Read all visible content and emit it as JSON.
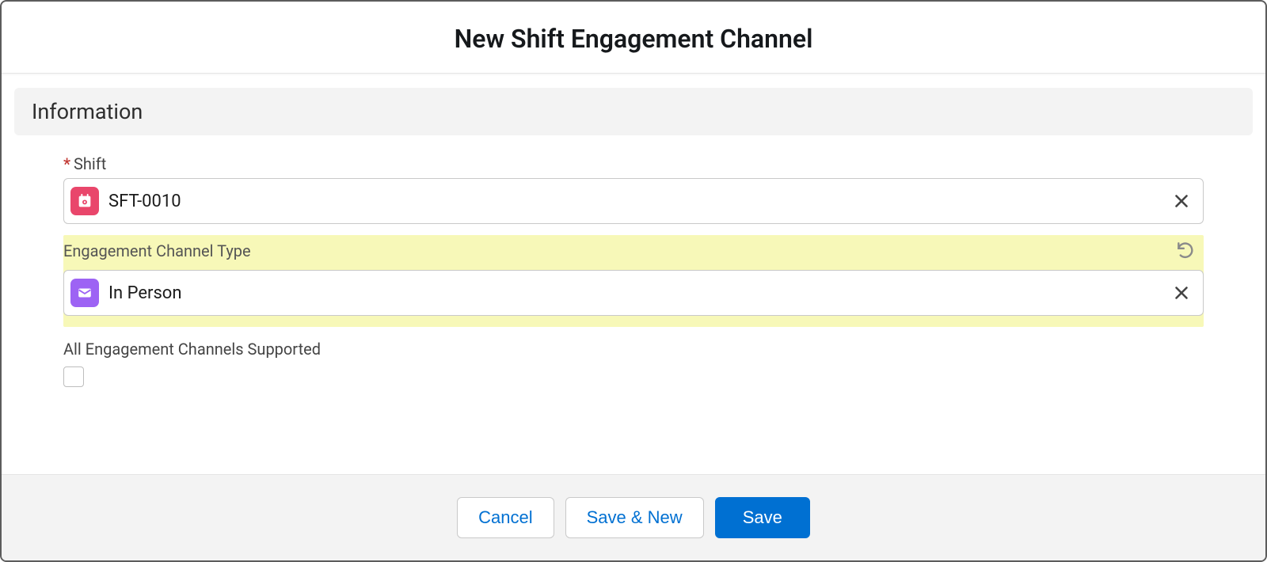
{
  "dialog": {
    "title": "New Shift Engagement Channel"
  },
  "section": {
    "heading": "Information"
  },
  "fields": {
    "shift": {
      "label": "Shift",
      "required_mark": "*",
      "value": "SFT-0010"
    },
    "engagement": {
      "label": "Engagement Channel Type",
      "value": "In Person"
    },
    "all_supported": {
      "label": "All Engagement Channels Supported",
      "checked": false
    }
  },
  "footer": {
    "cancel": "Cancel",
    "save_new": "Save & New",
    "save": "Save"
  }
}
